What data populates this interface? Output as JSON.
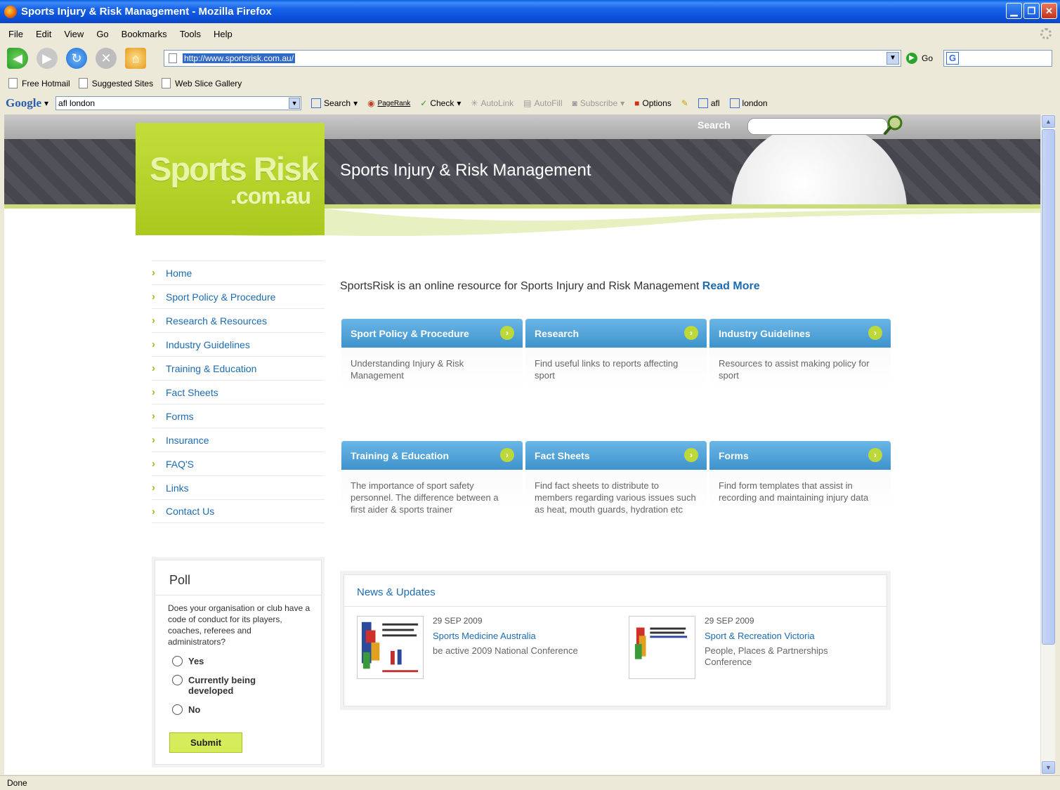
{
  "window": {
    "title": "Sports Injury & Risk Management - Mozilla Firefox"
  },
  "menu": [
    "File",
    "Edit",
    "View",
    "Go",
    "Bookmarks",
    "Tools",
    "Help"
  ],
  "navbar": {
    "url": "http://www.sportsrisk.com.au/",
    "go_label": "Go"
  },
  "bookmarks": [
    "Free Hotmail",
    "Suggested Sites",
    "Web Slice Gallery"
  ],
  "google_toolbar": {
    "logo": "Google",
    "query": "afl london",
    "search": "Search",
    "pagerank": "PageRank",
    "check": "Check",
    "autolink": "AutoLink",
    "autofill": "AutoFill",
    "subscribe": "Subscribe",
    "options": "Options",
    "term1": "afl",
    "term2": "london"
  },
  "site": {
    "search_label": "Search",
    "logo_main": "Sports Risk",
    "logo_sub": ".com.au",
    "tagline": "Sports  Injury & Risk Management"
  },
  "sidebar": {
    "items": [
      "Home",
      "Sport Policy & Procedure",
      "Research & Resources",
      "Industry Guidelines",
      "Training & Education",
      "Fact Sheets",
      "Forms",
      "Insurance",
      "FAQ'S",
      "Links",
      "Contact Us"
    ]
  },
  "poll": {
    "title": "Poll",
    "question": "Does your organisation or club have a code of conduct for its players, coaches, referees and administrators?",
    "options": [
      "Yes",
      "Currently being developed",
      "No"
    ],
    "submit": "Submit"
  },
  "intro": {
    "text": "SportsRisk is an online resource for Sports Injury and Risk Management",
    "more": "Read More"
  },
  "cards": [
    {
      "title": "Sport Policy & Procedure",
      "desc": "Understanding Injury & Risk Management"
    },
    {
      "title": "Research",
      "desc": "Find useful links to reports affecting sport"
    },
    {
      "title": "Industry Guidelines",
      "desc": "Resources to assist making policy for sport"
    },
    {
      "title": "Training & Education",
      "desc": "The importance of sport safety personnel. The difference between a first aider & sports trainer"
    },
    {
      "title": "Fact Sheets",
      "desc": "Find fact sheets to distribute to members regarding various issues such as heat, mouth guards, hydration etc"
    },
    {
      "title": "Forms",
      "desc": "Find form templates that assist in recording and maintaining injury data"
    }
  ],
  "news": {
    "title": "News & Updates",
    "items": [
      {
        "date": "29 SEP 2009",
        "org": "Sports Medicine Australia",
        "desc": "be active 2009 National Conference"
      },
      {
        "date": "29 SEP 2009",
        "org": "Sport & Recreation Victoria",
        "desc": "People, Places & Partnerships Conference"
      }
    ]
  },
  "status": {
    "text": "Done"
  }
}
